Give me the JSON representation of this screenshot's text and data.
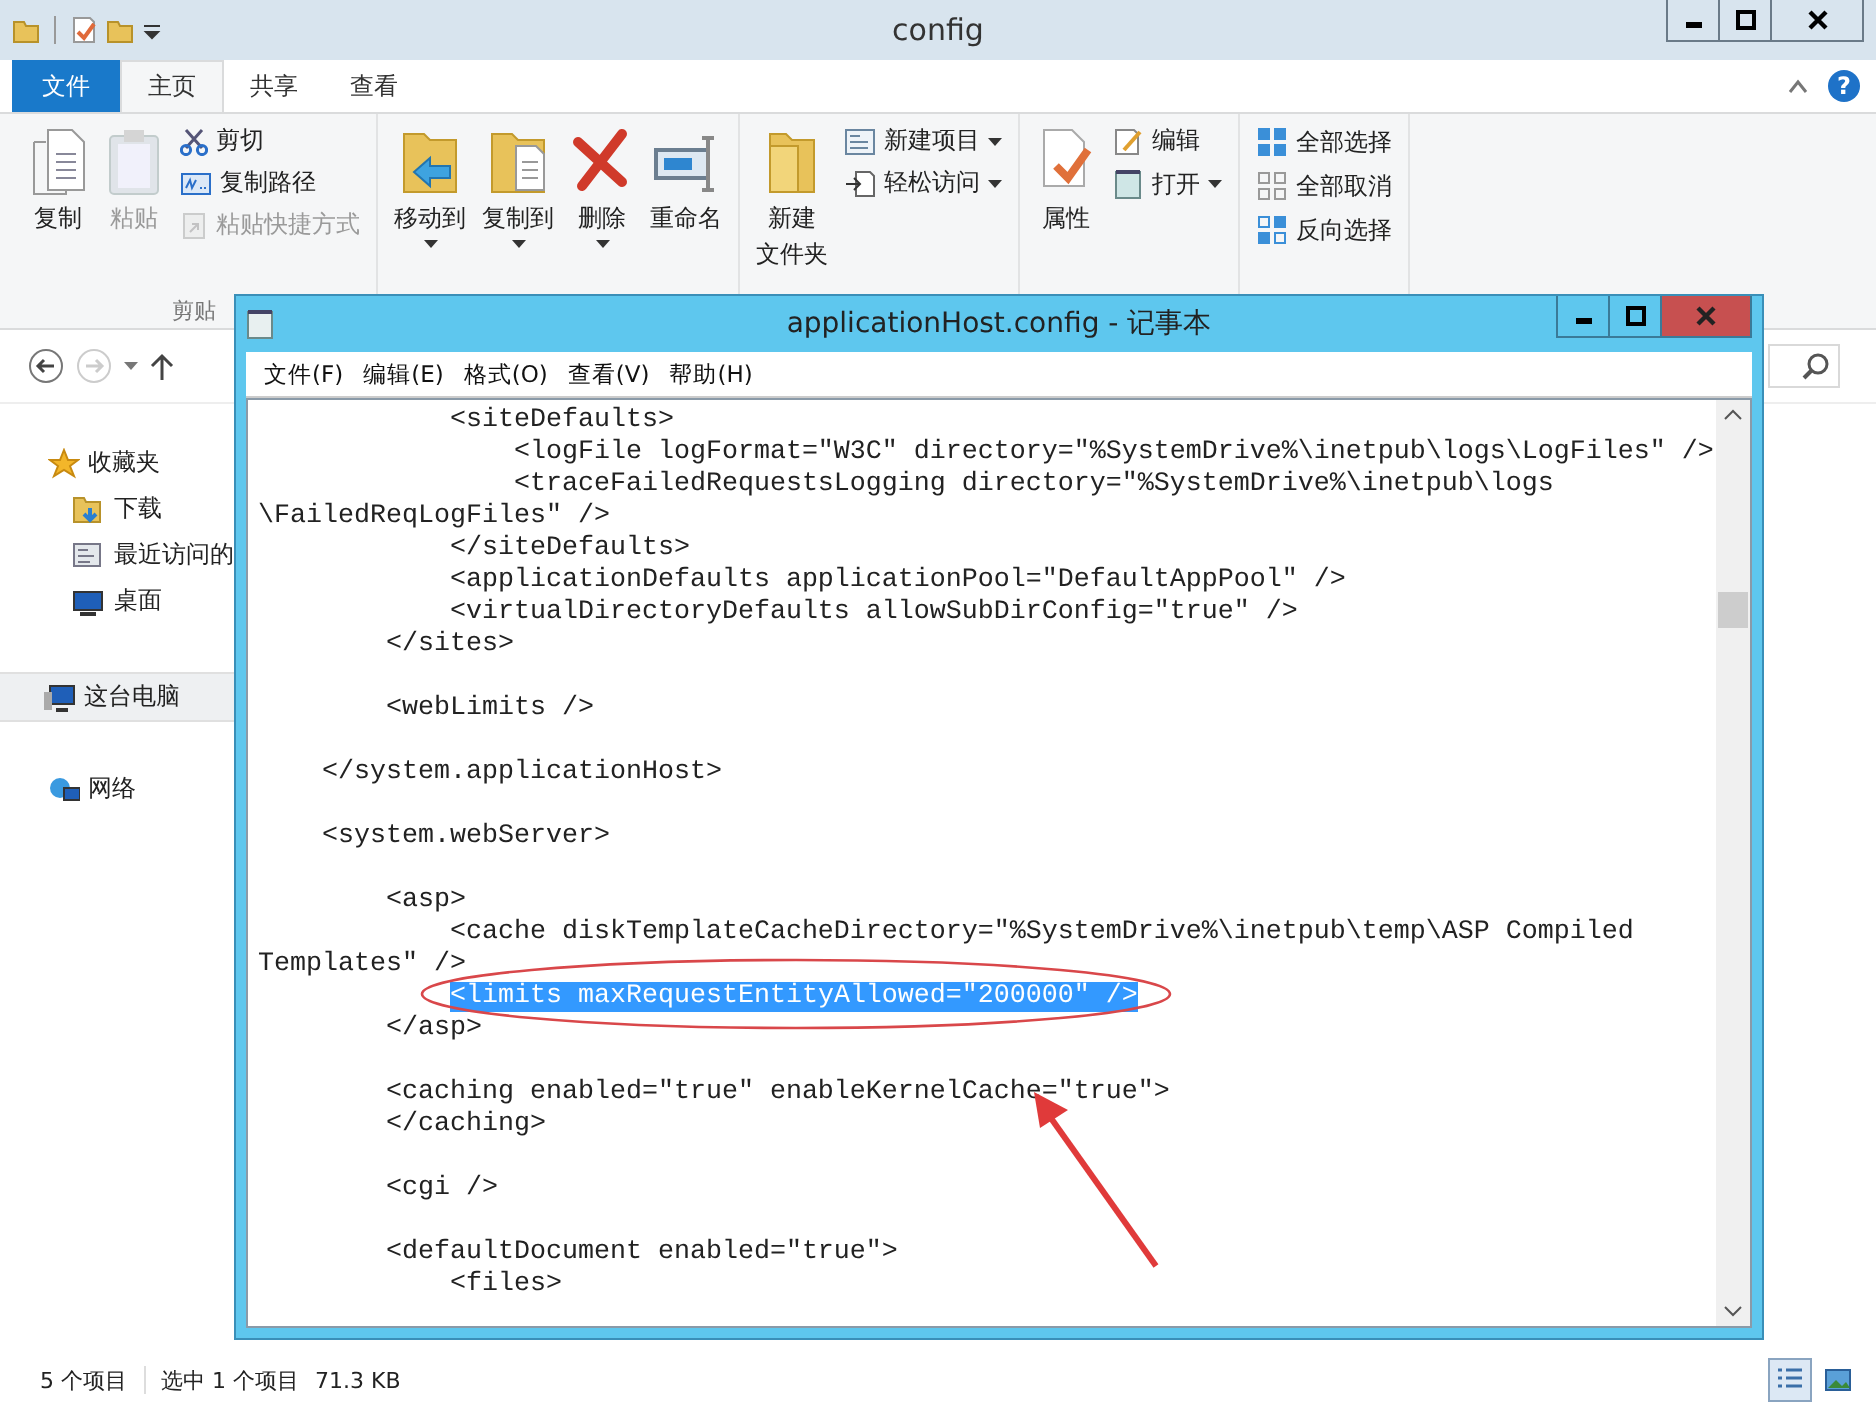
{
  "explorer": {
    "title": "config",
    "help_button": "?",
    "tabs": [
      {
        "label": "文件",
        "kind": "file",
        "selected": false
      },
      {
        "label": "主页",
        "kind": "tab",
        "selected": true
      },
      {
        "label": "共享",
        "kind": "tab",
        "selected": false
      },
      {
        "label": "查看",
        "kind": "tab",
        "selected": false
      }
    ],
    "ribbon": [
      {
        "label": "剪贴",
        "items": [
          {
            "kind": "large",
            "label": "复制",
            "disabled": false,
            "has_menu": false
          },
          {
            "kind": "large",
            "label": "粘贴",
            "disabled": true,
            "has_menu": false
          },
          {
            "kind": "small",
            "label": "剪切",
            "disabled": false,
            "has_menu": false
          },
          {
            "kind": "small",
            "label": "复制路径",
            "disabled": false,
            "has_menu": false
          },
          {
            "kind": "small",
            "label": "粘贴快捷方式",
            "disabled": true,
            "has_menu": false
          }
        ]
      },
      {
        "items": [
          {
            "kind": "large",
            "label": "移动到",
            "disabled": false,
            "has_menu": true
          },
          {
            "kind": "large",
            "label": "复制到",
            "disabled": false,
            "has_menu": true
          },
          {
            "kind": "large",
            "label": "删除",
            "disabled": false,
            "has_menu": true
          },
          {
            "kind": "large",
            "label": "重命名",
            "disabled": false,
            "has_menu": false
          }
        ]
      },
      {
        "items": [
          {
            "kind": "large",
            "label": "新建",
            "sublabel": "文件夹",
            "disabled": false,
            "has_menu": false
          },
          {
            "kind": "small",
            "label": "新建项目",
            "disabled": false,
            "has_menu": true
          },
          {
            "kind": "small",
            "label": "轻松访问",
            "disabled": false,
            "has_menu": true
          }
        ]
      },
      {
        "items": [
          {
            "kind": "large",
            "label": "属性",
            "disabled": false,
            "has_menu": false
          },
          {
            "kind": "small",
            "label": "编辑",
            "disabled": false,
            "has_menu": false
          },
          {
            "kind": "small",
            "label": "打开",
            "disabled": false,
            "has_menu": true
          }
        ]
      },
      {
        "items": [
          {
            "kind": "small",
            "label": "全部选择",
            "disabled": false,
            "has_menu": false
          },
          {
            "kind": "small",
            "label": "全部取消",
            "disabled": false,
            "has_menu": false
          },
          {
            "kind": "small",
            "label": "反向选择",
            "disabled": false,
            "has_menu": false
          }
        ]
      }
    ],
    "nav": [
      {
        "label": "收藏夹",
        "selected": false,
        "children": [
          {
            "label": "下载"
          },
          {
            "label": "最近访问的"
          },
          {
            "label": "桌面"
          }
        ]
      },
      {
        "label": "这台电脑",
        "selected": true
      },
      {
        "label": "网络",
        "selected": false
      }
    ],
    "status": {
      "count": "5 个项目",
      "selection": "选中 1 个项目",
      "size": "71.3 KB"
    },
    "view_buttons": [
      {
        "selected": true
      },
      {
        "selected": false
      }
    ]
  },
  "notepad": {
    "title": "applicationHost.config - 记事本",
    "menu": [
      "文件(F)",
      "编辑(E)",
      "格式(O)",
      "查看(V)",
      "帮助(H)"
    ],
    "lines": [
      {
        "kind": "text",
        "text": "            <siteDefaults>",
        "selected": false
      },
      {
        "kind": "text",
        "text": "                <logFile logFormat=\"W3C\" directory=\"%SystemDrive%\\inetpub\\logs\\LogFiles\" />",
        "selected": false
      },
      {
        "kind": "text",
        "text": "                <traceFailedRequestsLogging directory=\"%SystemDrive%\\inetpub\\logs",
        "selected": false
      },
      {
        "kind": "text",
        "text": "\\FailedReqLogFiles\" />",
        "selected": false
      },
      {
        "kind": "text",
        "text": "            </siteDefaults>",
        "selected": false
      },
      {
        "kind": "text",
        "text": "            <applicationDefaults applicationPool=\"DefaultAppPool\" />",
        "selected": false
      },
      {
        "kind": "text",
        "text": "            <virtualDirectoryDefaults allowSubDirConfig=\"true\" />",
        "selected": false
      },
      {
        "kind": "text",
        "text": "        </sites>",
        "selected": false
      },
      {
        "kind": "blank"
      },
      {
        "kind": "text",
        "text": "        <webLimits />",
        "selected": false
      },
      {
        "kind": "blank"
      },
      {
        "kind": "text",
        "text": "    </system.applicationHost>",
        "selected": false
      },
      {
        "kind": "blank"
      },
      {
        "kind": "text",
        "text": "    <system.webServer>",
        "selected": false
      },
      {
        "kind": "blank"
      },
      {
        "kind": "text",
        "text": "        <asp>",
        "selected": false
      },
      {
        "kind": "text",
        "text": "            <cache diskTemplateCacheDirectory=\"%SystemDrive%\\inetpub\\temp\\ASP Compiled",
        "selected": false
      },
      {
        "kind": "text",
        "text": "Templates\" />",
        "selected": false
      },
      {
        "kind": "text",
        "text": "            <limits maxRequestEntityAllowed=\"200000\" />",
        "selected": true
      },
      {
        "kind": "text",
        "text": "        </asp>",
        "selected": false
      },
      {
        "kind": "blank"
      },
      {
        "kind": "text",
        "text": "        <caching enabled=\"true\" enableKernelCache=\"true\">",
        "selected": false
      },
      {
        "kind": "text",
        "text": "        </caching>",
        "selected": false
      },
      {
        "kind": "blank"
      },
      {
        "kind": "text",
        "text": "        <cgi />",
        "selected": false
      },
      {
        "kind": "blank"
      },
      {
        "kind": "text",
        "text": "        <defaultDocument enabled=\"true\">",
        "selected": false
      },
      {
        "kind": "text",
        "text": "            <files>",
        "selected": false
      }
    ]
  }
}
